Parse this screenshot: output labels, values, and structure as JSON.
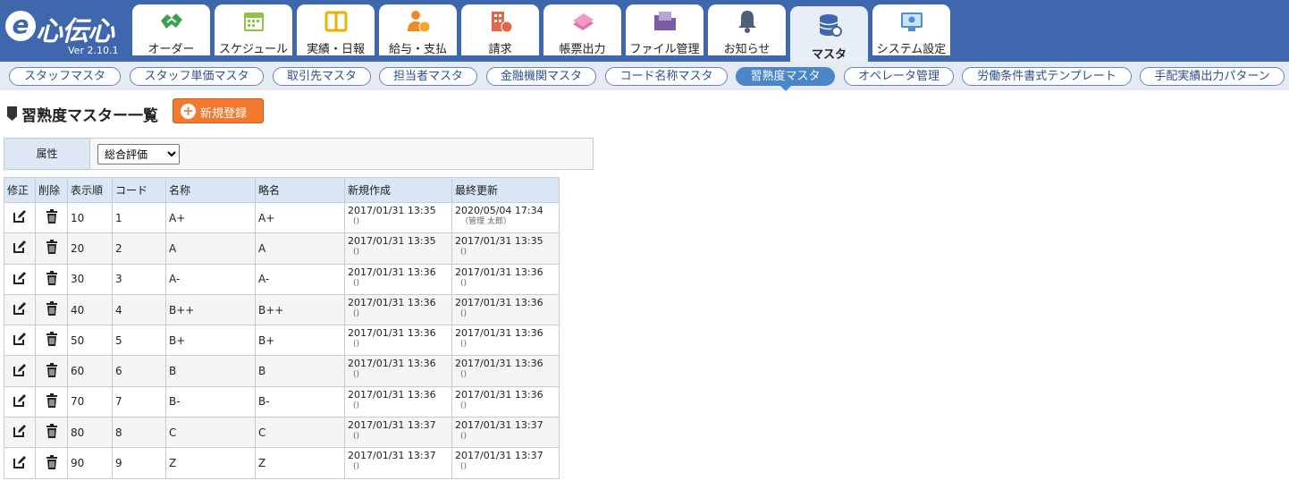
{
  "app": {
    "brand": "心伝心",
    "version": "Ver 2.10.1"
  },
  "header": {
    "tabs": [
      {
        "label": "オーダー",
        "icon": "handshake-icon"
      },
      {
        "label": "スケジュール",
        "icon": "calendar-icon"
      },
      {
        "label": "実績・日報",
        "icon": "book-icon"
      },
      {
        "label": "給与・支払",
        "icon": "person-money-icon"
      },
      {
        "label": "請求",
        "icon": "building-money-icon"
      },
      {
        "label": "帳票出力",
        "icon": "documents-icon"
      },
      {
        "label": "ファイル管理",
        "icon": "folder-icon"
      },
      {
        "label": "お知らせ",
        "icon": "bell-icon"
      },
      {
        "label": "マスタ",
        "icon": "database-gear-icon",
        "active": true
      },
      {
        "label": "システム設定",
        "icon": "monitor-gear-icon"
      }
    ]
  },
  "subnav": {
    "items": [
      "スタッフマスタ",
      "スタッフ単価マスタ",
      "取引先マスタ",
      "担当者マスタ",
      "金融機関マスタ",
      "コード名称マスタ",
      "習熟度マスタ",
      "オペレータ管理",
      "労働条件書式テンプレート",
      "手配実績出力パターン"
    ],
    "active": 6
  },
  "page": {
    "title": "習熟度マスター一覧",
    "new_button": "新規登録"
  },
  "filter": {
    "label": "属性",
    "selected": "総合評価"
  },
  "table": {
    "headers": [
      "修正",
      "削除",
      "表示順",
      "コード",
      "名称",
      "略名",
      "新規作成",
      "最終更新"
    ],
    "rows": [
      {
        "order": "10",
        "code": "1",
        "name": "A+",
        "short": "A+",
        "created": "2017/01/31 13:35",
        "created_by": "()",
        "updated": "2020/05/04 17:34",
        "updated_by": "（管理 太郎）"
      },
      {
        "order": "20",
        "code": "2",
        "name": "A",
        "short": "A",
        "created": "2017/01/31 13:35",
        "created_by": "()",
        "updated": "2017/01/31 13:35",
        "updated_by": "()"
      },
      {
        "order": "30",
        "code": "3",
        "name": "A-",
        "short": "A-",
        "created": "2017/01/31 13:36",
        "created_by": "()",
        "updated": "2017/01/31 13:36",
        "updated_by": "()"
      },
      {
        "order": "40",
        "code": "4",
        "name": "B++",
        "short": "B++",
        "created": "2017/01/31 13:36",
        "created_by": "()",
        "updated": "2017/01/31 13:36",
        "updated_by": "()"
      },
      {
        "order": "50",
        "code": "5",
        "name": "B+",
        "short": "B+",
        "created": "2017/01/31 13:36",
        "created_by": "()",
        "updated": "2017/01/31 13:36",
        "updated_by": "()"
      },
      {
        "order": "60",
        "code": "6",
        "name": "B",
        "short": "B",
        "created": "2017/01/31 13:36",
        "created_by": "()",
        "updated": "2017/01/31 13:36",
        "updated_by": "()"
      },
      {
        "order": "70",
        "code": "7",
        "name": "B-",
        "short": "B-",
        "created": "2017/01/31 13:36",
        "created_by": "()",
        "updated": "2017/01/31 13:36",
        "updated_by": "()"
      },
      {
        "order": "80",
        "code": "8",
        "name": "C",
        "short": "C",
        "created": "2017/01/31 13:37",
        "created_by": "()",
        "updated": "2017/01/31 13:37",
        "updated_by": "()"
      },
      {
        "order": "90",
        "code": "9",
        "name": "Z",
        "short": "Z",
        "created": "2017/01/31 13:37",
        "created_by": "()",
        "updated": "2017/01/31 13:37",
        "updated_by": "()"
      }
    ]
  },
  "colors": {
    "header_bg": "#3e67ad",
    "accent_button": "#f2792e",
    "subnav_active": "#4a86c8",
    "table_header": "#d8e6f5"
  }
}
